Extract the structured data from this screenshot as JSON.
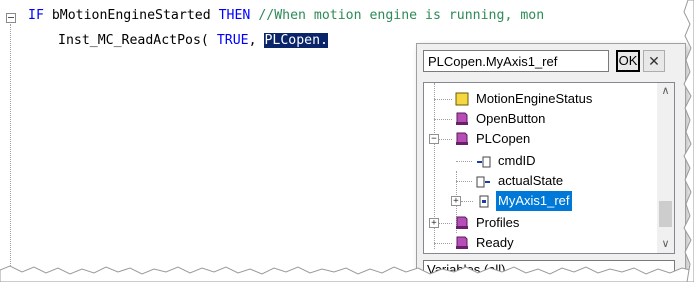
{
  "editor": {
    "line1": {
      "kw_if": "IF",
      "var": "bMotionEngineStarted",
      "kw_then": "THEN",
      "comment": "//When motion engine is running, mon"
    },
    "line2": {
      "call": "Inst_MC_ReadActPos(",
      "kw_true": "TRUE",
      "comma": ",",
      "selected": "PLCopen."
    }
  },
  "autocomplete": {
    "path_value": "PLCopen.MyAxis1_ref",
    "ok_label": "OK",
    "close_label": "✕",
    "filter_label": "Variables (all)",
    "items": [
      {
        "label": "MotionEngineStatus",
        "icon": "folder-icon"
      },
      {
        "label": "OpenButton",
        "icon": "object-icon"
      },
      {
        "label": "PLCopen",
        "icon": "object-icon"
      },
      {
        "label": "cmdID",
        "icon": "input-variable-icon"
      },
      {
        "label": "actualState",
        "icon": "output-variable-icon"
      },
      {
        "label": "MyAxis1_ref",
        "icon": "reference-variable-icon"
      },
      {
        "label": "Profiles",
        "icon": "object-icon"
      },
      {
        "label": "Ready",
        "icon": "object-icon"
      }
    ],
    "colors": {
      "selection": "#0078d7",
      "object_icon": "#8b2a8b",
      "folder_icon": "#f5d742"
    }
  }
}
